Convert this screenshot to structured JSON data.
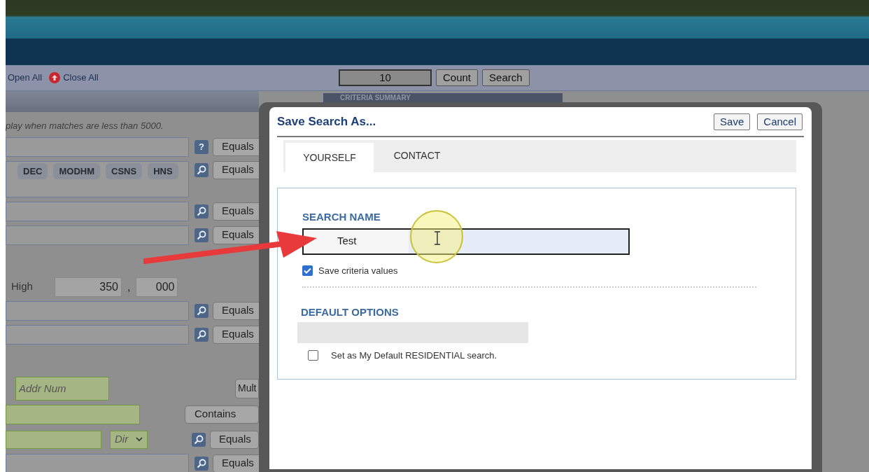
{
  "toolbar": {
    "open_all": "Open All",
    "close_all": "Close All",
    "count_value": "10",
    "buttons": [
      "Count",
      "Search"
    ]
  },
  "criteria_summary": "CRITERIA SUMMARY",
  "form": {
    "note": "play when matches are less than 5000.",
    "rows": [
      {
        "kind": "field",
        "help": "?",
        "operator": "Equals"
      },
      {
        "kind": "tags",
        "tags": [
          "DEC",
          "MODHM",
          "CSNS",
          "HNS"
        ],
        "operator": "Equals"
      },
      {
        "kind": "field",
        "operator": "Equals"
      },
      {
        "kind": "field",
        "operator": "Equals"
      },
      {
        "kind": "range",
        "label": "High",
        "values": [
          "350",
          "000"
        ],
        "separator": ","
      },
      {
        "kind": "field",
        "operator": "Equals"
      },
      {
        "kind": "field",
        "operator": "Equals"
      },
      {
        "kind": "address",
        "placeholder": "Addr Num",
        "button": "Mult"
      },
      {
        "kind": "text",
        "operator": "Contains"
      },
      {
        "kind": "street",
        "select": "Dir",
        "operator": "Equals"
      },
      {
        "kind": "field",
        "operator": "Equals"
      }
    ]
  },
  "dialog": {
    "title": "Save Search As...",
    "buttons": [
      "Save",
      "Cancel"
    ],
    "tabs": [
      {
        "label": "YOURSELF",
        "selected": true
      },
      {
        "label": "CONTACT",
        "selected": false
      }
    ],
    "search_name": {
      "label": "SEARCH NAME",
      "value": "Test"
    },
    "save_criteria": {
      "label": "Save criteria values",
      "checked": true
    },
    "default_options": {
      "label": "DEFAULT OPTIONS",
      "option": {
        "label": "Set as My Default RESIDENTIAL search.",
        "checked": false
      }
    }
  }
}
